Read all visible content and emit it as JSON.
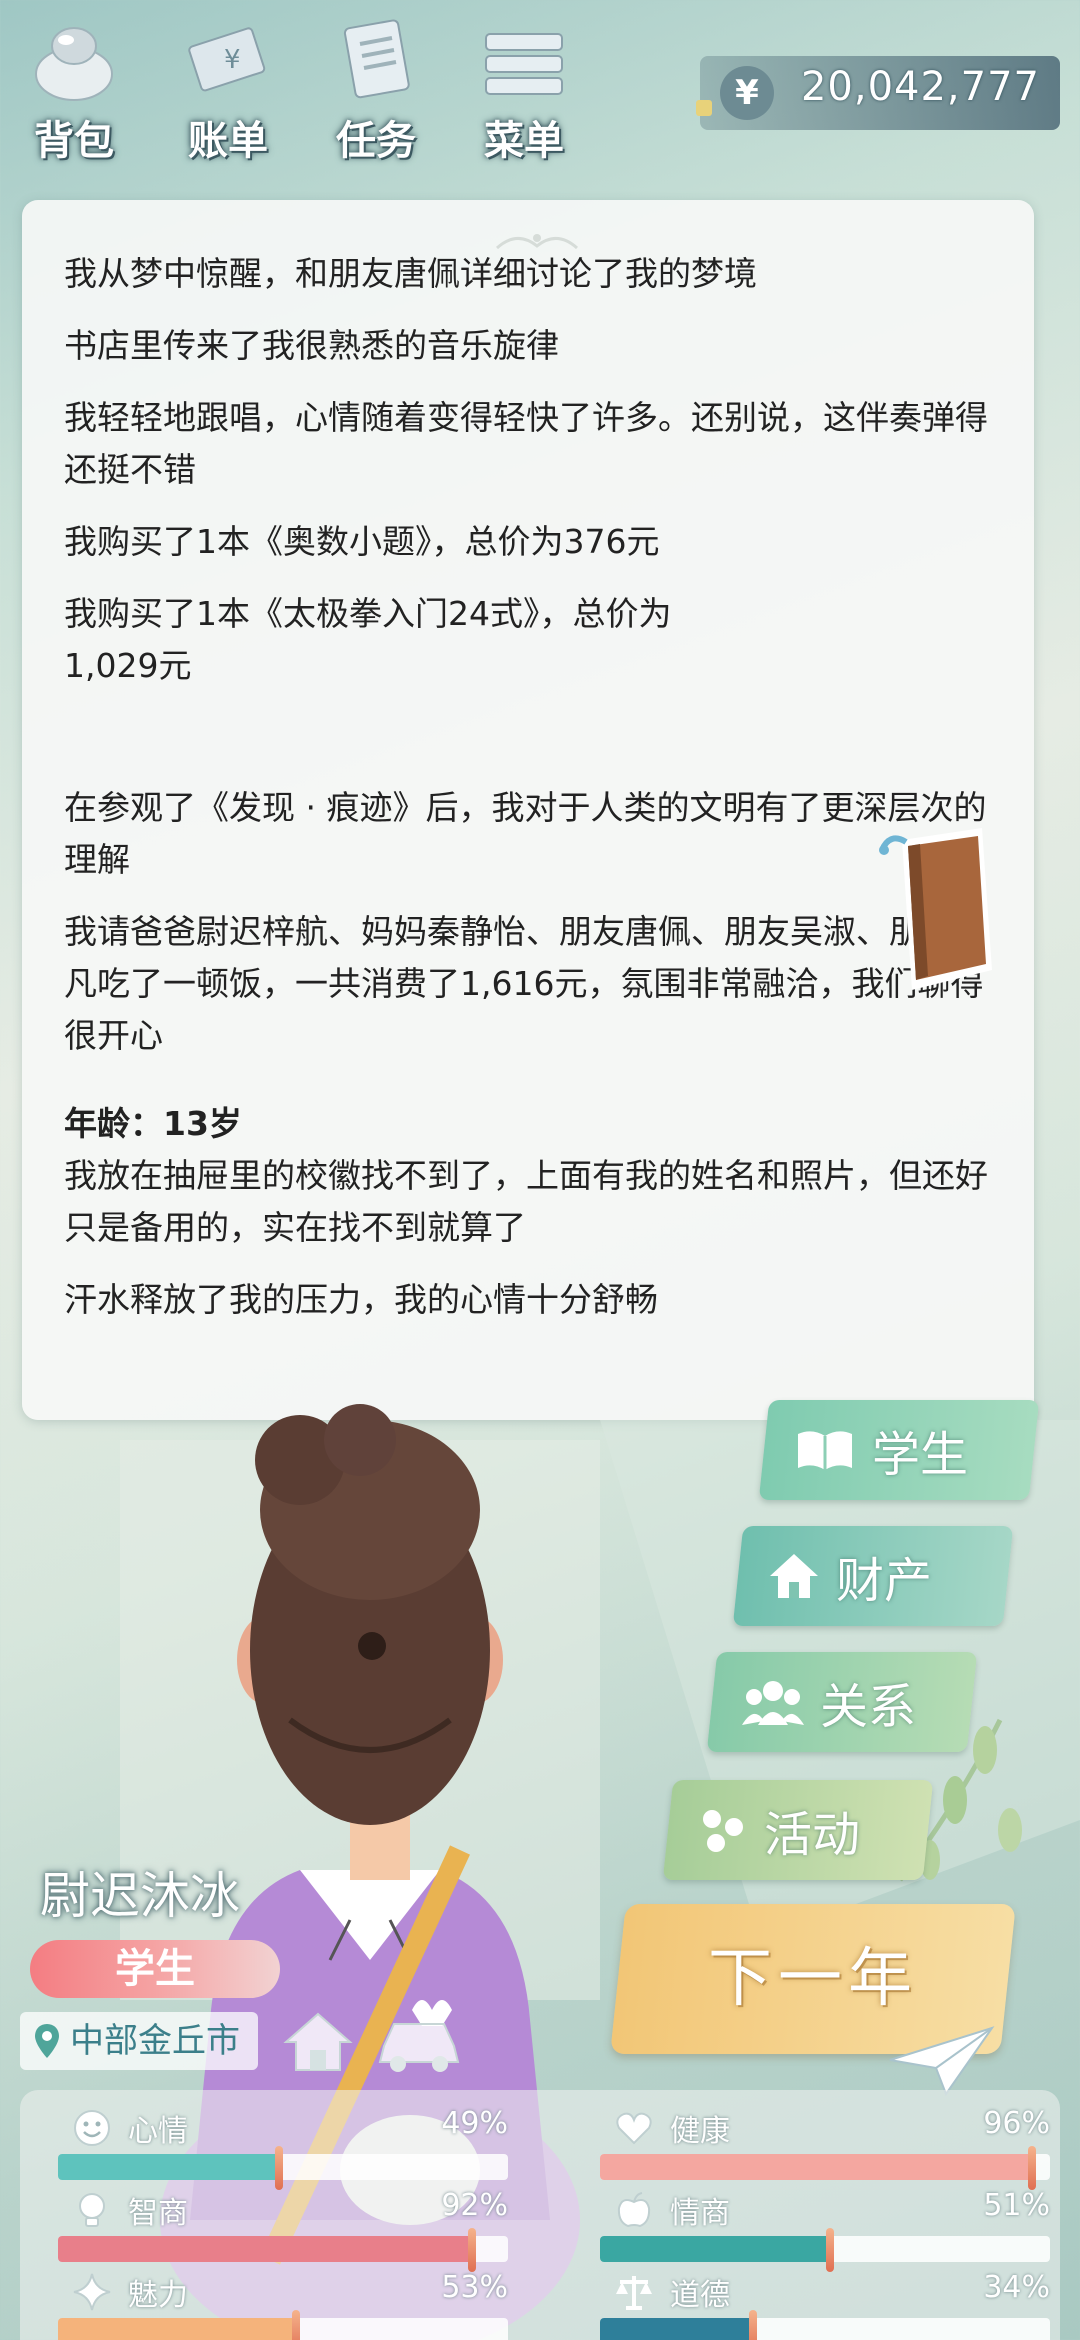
{
  "topbar": {
    "buttons": [
      {
        "label": "背包",
        "icon": "backpack-icon"
      },
      {
        "label": "账单",
        "icon": "bill-icon"
      },
      {
        "label": "任务",
        "icon": "task-icon"
      },
      {
        "label": "菜单",
        "icon": "menu-icon"
      }
    ],
    "currency_symbol": "¥",
    "money": "20,042,777"
  },
  "log": {
    "entries": [
      "我从梦中惊醒，和朋友唐佩详细讨论了我的梦境",
      "书店里传来了我很熟悉的音乐旋律",
      "我轻轻地跟唱，心情随着变得轻快了许多。还别说，这伴奏弹得还挺不错",
      "我购买了1本《奥数小题》，总价为376元",
      "我购买了1本《太极拳入门24式》，总价为1,029元",
      "在参观了《发现 · 痕迹》后，我对于人类的文明有了更深层次的理解",
      "我请爸爸尉迟梓航、妈妈秦静怡、朋友唐佩、朋友吴淑、朋友问凡吃了一顿饭，一共消费了1,616元，氛围非常融洽，我们聊得很开心"
    ],
    "age_label": "年龄：13岁",
    "age_entries": [
      "我放在抽屉里的校徽找不到了，上面有我的姓名和照片，但还好只是备用的，实在找不到就算了",
      "汗水释放了我的压力，我的心情十分舒畅"
    ]
  },
  "side_menu": {
    "student": "学生",
    "assets": "财产",
    "relations": "关系",
    "activities": "活动"
  },
  "next_year": "下一年",
  "player": {
    "name": "尉迟沐冰",
    "tag": "学生",
    "location": "中部金丘市"
  },
  "stats": {
    "mood": {
      "label": "心情",
      "value": "49%",
      "fill": 0.49,
      "color": "#5ec3bd",
      "icon": "smile-icon"
    },
    "health": {
      "label": "健康",
      "value": "96%",
      "fill": 0.96,
      "color": "#f4a7a0",
      "icon": "heart-icon"
    },
    "iq": {
      "label": "智商",
      "value": "92%",
      "fill": 0.92,
      "color": "#e87f8a",
      "icon": "bulb-icon"
    },
    "eq": {
      "label": "情商",
      "value": "51%",
      "fill": 0.51,
      "color": "#3aa7a2",
      "icon": "apple-icon"
    },
    "charm": {
      "label": "魅力",
      "value": "53%",
      "fill": 0.53,
      "color": "#f5b37b",
      "icon": "sparkle-icon"
    },
    "moral": {
      "label": "道德",
      "value": "34%",
      "fill": 0.34,
      "color": "#2e7f9a",
      "icon": "scale-icon"
    }
  }
}
